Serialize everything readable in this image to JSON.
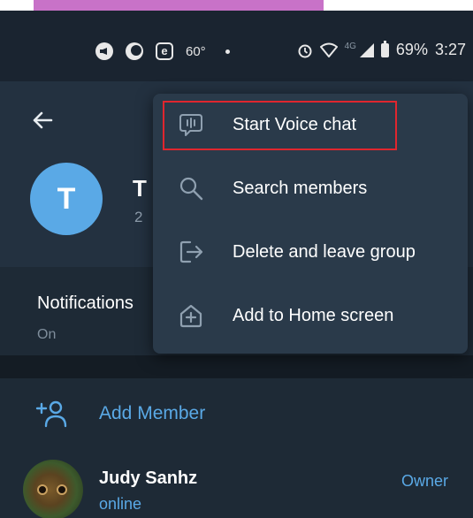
{
  "status_bar": {
    "temperature": "60°",
    "network": "4G",
    "battery": "69%",
    "time": "3:27",
    "icons": [
      "volume-icon",
      "moon-icon",
      "e-icon",
      "alarm-icon",
      "wifi-icon",
      "signal-icon",
      "battery-icon"
    ]
  },
  "header": {
    "avatar_letter": "T",
    "avatar_color": "#5aa9e6",
    "group_name_visible": "T",
    "group_sub_visible": "2"
  },
  "notifications": {
    "label": "Notifications",
    "value": "On"
  },
  "menu": {
    "items": [
      {
        "label": "Start Voice chat",
        "icon": "voice-chat-icon",
        "highlighted": true
      },
      {
        "label": "Search members",
        "icon": "search-icon"
      },
      {
        "label": "Delete and leave group",
        "icon": "leave-icon"
      },
      {
        "label": "Add to Home screen",
        "icon": "add-home-icon"
      }
    ]
  },
  "members": {
    "add_member_label": "Add Member",
    "list": [
      {
        "name": "Judy Sanhz",
        "status": "online",
        "role": "Owner"
      }
    ]
  },
  "colors": {
    "accent": "#5aa9e6",
    "highlight_border": "#e0262e",
    "background": "#1b2733"
  }
}
